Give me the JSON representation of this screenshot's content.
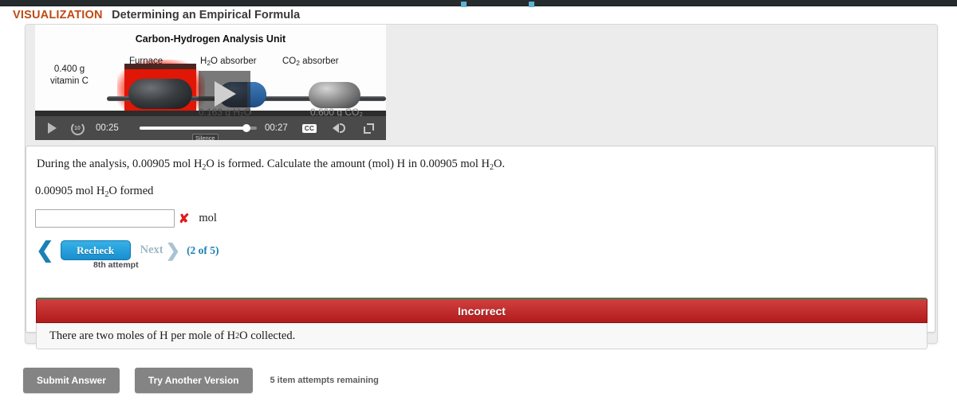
{
  "topbar": {
    "dots": 2
  },
  "header": {
    "kicker": "VISUALIZATION",
    "title": "Determining an Empirical Formula",
    "kicker_color": "#bf4a15"
  },
  "video": {
    "heading": "Carbon-Hydrogen Analysis Unit",
    "labels": {
      "sample_line1": "0.400 g",
      "sample_line2": "vitamin C",
      "furnace": "Furnace",
      "h2o_absorber_pre": "H",
      "h2o_absorber_sub": "2",
      "h2o_absorber_post": "O absorber",
      "co2_absorber_pre": "CO",
      "co2_absorber_sub": "2",
      "co2_absorber_post": " absorber"
    },
    "readouts": {
      "h2o_mass": "0.163 g H₂O",
      "co2_mass": "0.600 g CO₂"
    },
    "controls": {
      "play": "play-button",
      "rewind_seconds": "10",
      "current_time": "00:25",
      "total_time": "00:27",
      "cc_label": "CC",
      "silence_tooltip": "Silence",
      "progress_percent": 92
    }
  },
  "question": {
    "prompt_part1": "During the analysis, 0.00905 mol H",
    "prompt_sub1": "2",
    "prompt_part2": "O is formed. Calculate the amount (mol) H in 0.00905 mol H",
    "prompt_sub2": "2",
    "prompt_part3": "O.",
    "given_part1": "0.00905 mol H",
    "given_sub": "2",
    "given_part2": "O formed",
    "answer_value": "",
    "answer_placeholder": "",
    "answer_mark": "✘",
    "answer_unit": "mol"
  },
  "nav": {
    "prev_chevron": "❮",
    "recheck_label": "Recheck",
    "next_label": "Next",
    "next_chevron": "❯",
    "progress_count": "(2 of 5)",
    "attempt_note": "8th attempt"
  },
  "feedback": {
    "status": "Incorrect",
    "status_color": "#b31b1b",
    "message_part1": "There are two moles of H per mole of H",
    "message_sub": "2",
    "message_part2": "O collected."
  },
  "actions": {
    "submit_label": "Submit Answer",
    "try_another_label": "Try Another Version",
    "attempts_remaining": "5 item attempts remaining"
  }
}
